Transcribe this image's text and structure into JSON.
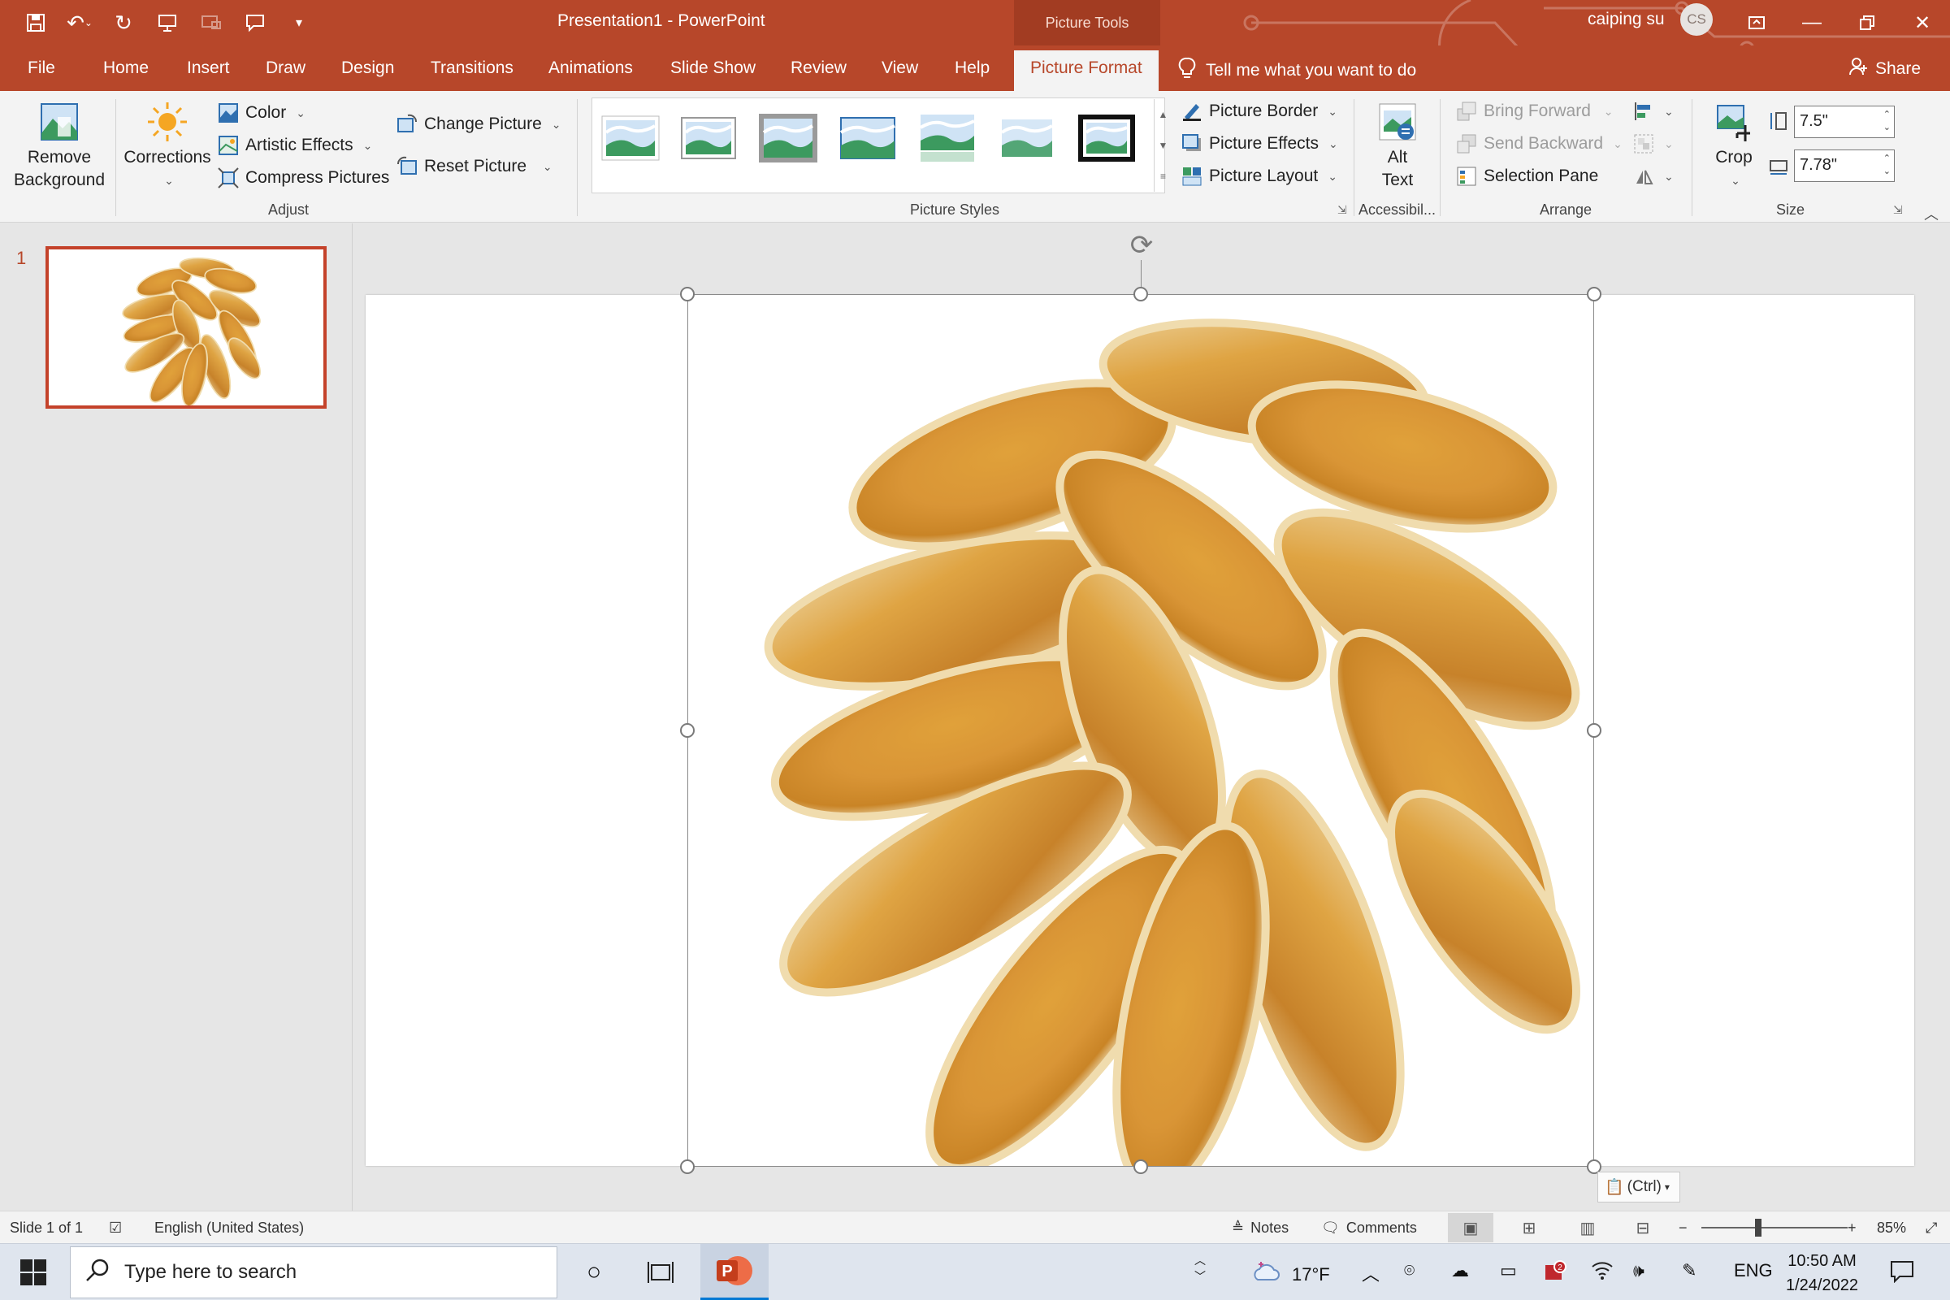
{
  "window": {
    "title": "Presentation1  -  PowerPoint",
    "context_tab": "Picture Tools",
    "user_name": "caiping su",
    "user_initials": "CS"
  },
  "tabs": [
    "File",
    "Home",
    "Insert",
    "Draw",
    "Design",
    "Transitions",
    "Animations",
    "Slide Show",
    "Review",
    "View",
    "Help",
    "Picture Format"
  ],
  "active_tab": "Picture Format",
  "tell_me": "Tell me what you want to do",
  "share": "Share",
  "ribbon": {
    "adjust": {
      "label": "Adjust",
      "remove_bg_1": "Remove",
      "remove_bg_2": "Background",
      "corrections": "Corrections",
      "color": "Color",
      "artistic": "Artistic Effects",
      "compress": "Compress Pictures",
      "change": "Change Picture",
      "reset": "Reset Picture"
    },
    "styles": {
      "label": "Picture Styles",
      "border": "Picture Border",
      "effects": "Picture Effects",
      "layout": "Picture Layout"
    },
    "accessibility": {
      "label": "Accessibil...",
      "alt_1": "Alt",
      "alt_2": "Text"
    },
    "arrange": {
      "label": "Arrange",
      "bring": "Bring Forward",
      "send": "Send Backward",
      "selection": "Selection Pane"
    },
    "size": {
      "label": "Size",
      "crop": "Crop",
      "height": "7.5\"",
      "width": "7.78\""
    }
  },
  "slides": {
    "current_number": "1"
  },
  "paste_options": "(Ctrl)",
  "status": {
    "slide": "Slide 1 of 1",
    "language": "English (United States)",
    "notes": "Notes",
    "comments": "Comments",
    "zoom": "85%"
  },
  "taskbar": {
    "search_placeholder": "Type here to search",
    "weather": "17°F",
    "language": "ENG",
    "time": "10:50 AM",
    "date": "1/24/2022"
  },
  "colors": {
    "accent": "#b7472a",
    "ribbon_bg": "#f3f3f3"
  }
}
